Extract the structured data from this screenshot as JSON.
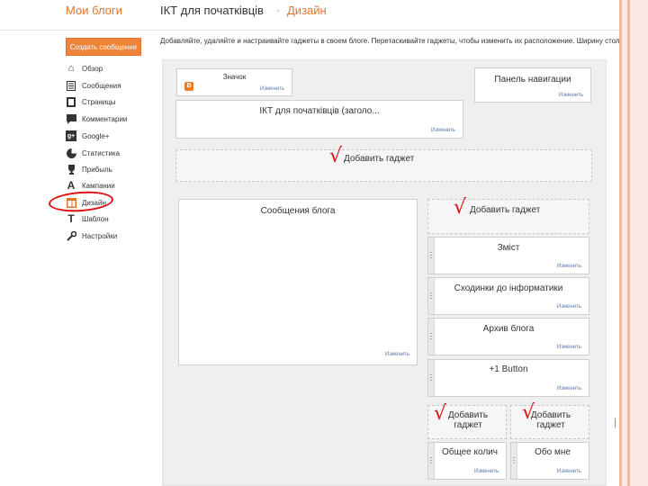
{
  "header": {
    "app_title": "Мои блоги",
    "blog_title": "ІКТ для початківців",
    "separator": "·",
    "section": "Дизайн"
  },
  "sidebar": {
    "new_post_label": "Создать сообщение",
    "items": [
      {
        "label": "Обзор",
        "icon": "home-icon"
      },
      {
        "label": "Сообщения",
        "icon": "posts-icon"
      },
      {
        "label": "Страницы",
        "icon": "pages-icon"
      },
      {
        "label": "Комментарии",
        "icon": "comments-icon"
      },
      {
        "label": "Google+",
        "icon": "google-plus-icon"
      },
      {
        "label": "Статистика",
        "icon": "stats-icon"
      },
      {
        "label": "Прибыль",
        "icon": "trophy-icon"
      },
      {
        "label": "Кампании",
        "icon": "campaigns-icon"
      },
      {
        "label": "Дизайн",
        "icon": "layout-icon"
      },
      {
        "label": "Шаблон",
        "icon": "template-icon"
      },
      {
        "label": "Настройки",
        "icon": "wrench-icon"
      }
    ]
  },
  "instruction": "Добавляйте, удаляйте и настраивайте гаджеты в своем блоге. Перетаскивайте гаджеты, чтобы изменить их расположение. Ширину стол",
  "layout": {
    "favicon": {
      "title": "Значок",
      "edit": "Изменить"
    },
    "navbar": {
      "title": "Панель навигации",
      "edit": "Изменить"
    },
    "header": {
      "title": "ІКТ для початківців (заголо...",
      "edit": "Изменить"
    },
    "add_gadget_top": "Добавить гаджет",
    "posts": {
      "title": "Сообщения блога",
      "edit": "Изменить"
    },
    "add_gadget_sidebar": "Добавить гаджет",
    "sidebar_gadgets": [
      {
        "title": "Зміст",
        "edit": "Изменить"
      },
      {
        "title": "Сходинки до інформатики",
        "edit": "Изменить"
      },
      {
        "title": "Архив блога",
        "edit": "Изменить"
      },
      {
        "title": "+1 Button",
        "edit": "Изменить"
      }
    ],
    "add_gadget_left": "Добавить гаджет",
    "add_gadget_right": "Добавить гаджет",
    "footer_left": {
      "title": "Общее колич",
      "edit": "Изменить"
    },
    "footer_right": {
      "title": "Обо мне",
      "edit": "Изменить"
    }
  },
  "colors": {
    "accent": "#e1762b",
    "button": "#f0833a",
    "annotation": "#dd1111"
  }
}
